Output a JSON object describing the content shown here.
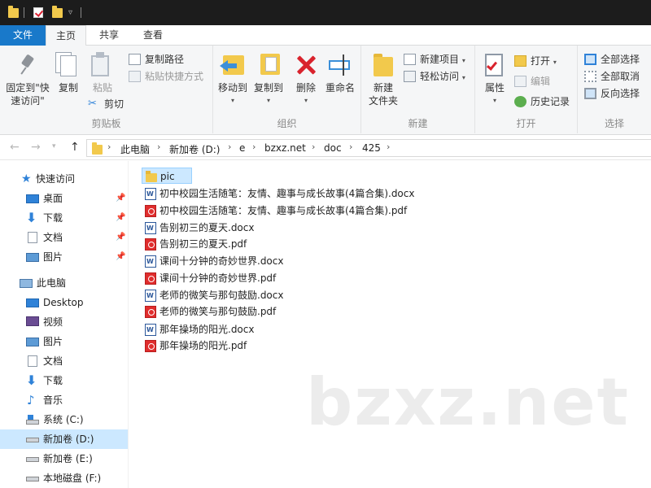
{
  "titlebar": {
    "quick_access": [
      "folder-icon",
      "properties-check-icon",
      "new-folder-icon",
      "customize-dropdown-icon"
    ]
  },
  "ribbon_tabs": {
    "file": "文件",
    "home": "主页",
    "share": "共享",
    "view": "查看"
  },
  "ribbon": {
    "clipboard": {
      "pin_quick_access": "固定到\"快",
      "pin_quick_access_line2": "速访问\"",
      "copy": "复制",
      "paste": "粘贴",
      "copy_path": "复制路径",
      "paste_shortcut": "粘贴快捷方式",
      "cut": "剪切",
      "group": "剪贴板"
    },
    "organize": {
      "move_to": "移动到",
      "copy_to": "复制到",
      "delete": "删除",
      "rename": "重命名",
      "group": "组织"
    },
    "new": {
      "new_folder": "新建",
      "new_folder_line2": "文件夹",
      "new_item": "新建项目",
      "easy_access": "轻松访问",
      "group": "新建"
    },
    "open": {
      "properties": "属性",
      "open": "打开",
      "edit": "编辑",
      "history": "历史记录",
      "group": "打开"
    },
    "select": {
      "select_all": "全部选择",
      "select_none": "全部取消",
      "invert": "反向选择",
      "group": "选择"
    }
  },
  "address": {
    "crumbs": [
      "此电脑",
      "新加卷 (D:)",
      "e",
      "bzxz.net",
      "doc",
      "425"
    ]
  },
  "navpane": {
    "quick_access": "快速访问",
    "items_pinned": [
      "桌面",
      "下载",
      "文档",
      "图片"
    ],
    "this_pc": "此电脑",
    "pc_items": [
      "Desktop",
      "视频",
      "图片",
      "文档",
      "下载",
      "音乐",
      "系统 (C:)",
      "新加卷 (D:)",
      "新加卷 (E:)",
      "本地磁盘 (F:)"
    ]
  },
  "files": [
    {
      "name": "pic",
      "type": "folder"
    },
    {
      "name": "初中校园生活随笔：友情、趣事与成长故事(4篇合集).docx",
      "type": "docx"
    },
    {
      "name": "初中校园生活随笔：友情、趣事与成长故事(4篇合集).pdf",
      "type": "pdf"
    },
    {
      "name": "告别初三的夏天.docx",
      "type": "docx"
    },
    {
      "name": "告别初三的夏天.pdf",
      "type": "pdf"
    },
    {
      "name": "课间十分钟的奇妙世界.docx",
      "type": "docx"
    },
    {
      "name": "课间十分钟的奇妙世界.pdf",
      "type": "pdf"
    },
    {
      "name": "老师的微笑与那句鼓励.docx",
      "type": "docx"
    },
    {
      "name": "老师的微笑与那句鼓励.pdf",
      "type": "pdf"
    },
    {
      "name": "那年操场的阳光.docx",
      "type": "docx"
    },
    {
      "name": "那年操场的阳光.pdf",
      "type": "pdf"
    }
  ],
  "watermark": "bzxz.net",
  "colors": {
    "accent": "#1979ca",
    "selection": "#cce8ff",
    "folder": "#f2c94c",
    "pdf": "#e02d2d",
    "docx": "#2b579a"
  }
}
